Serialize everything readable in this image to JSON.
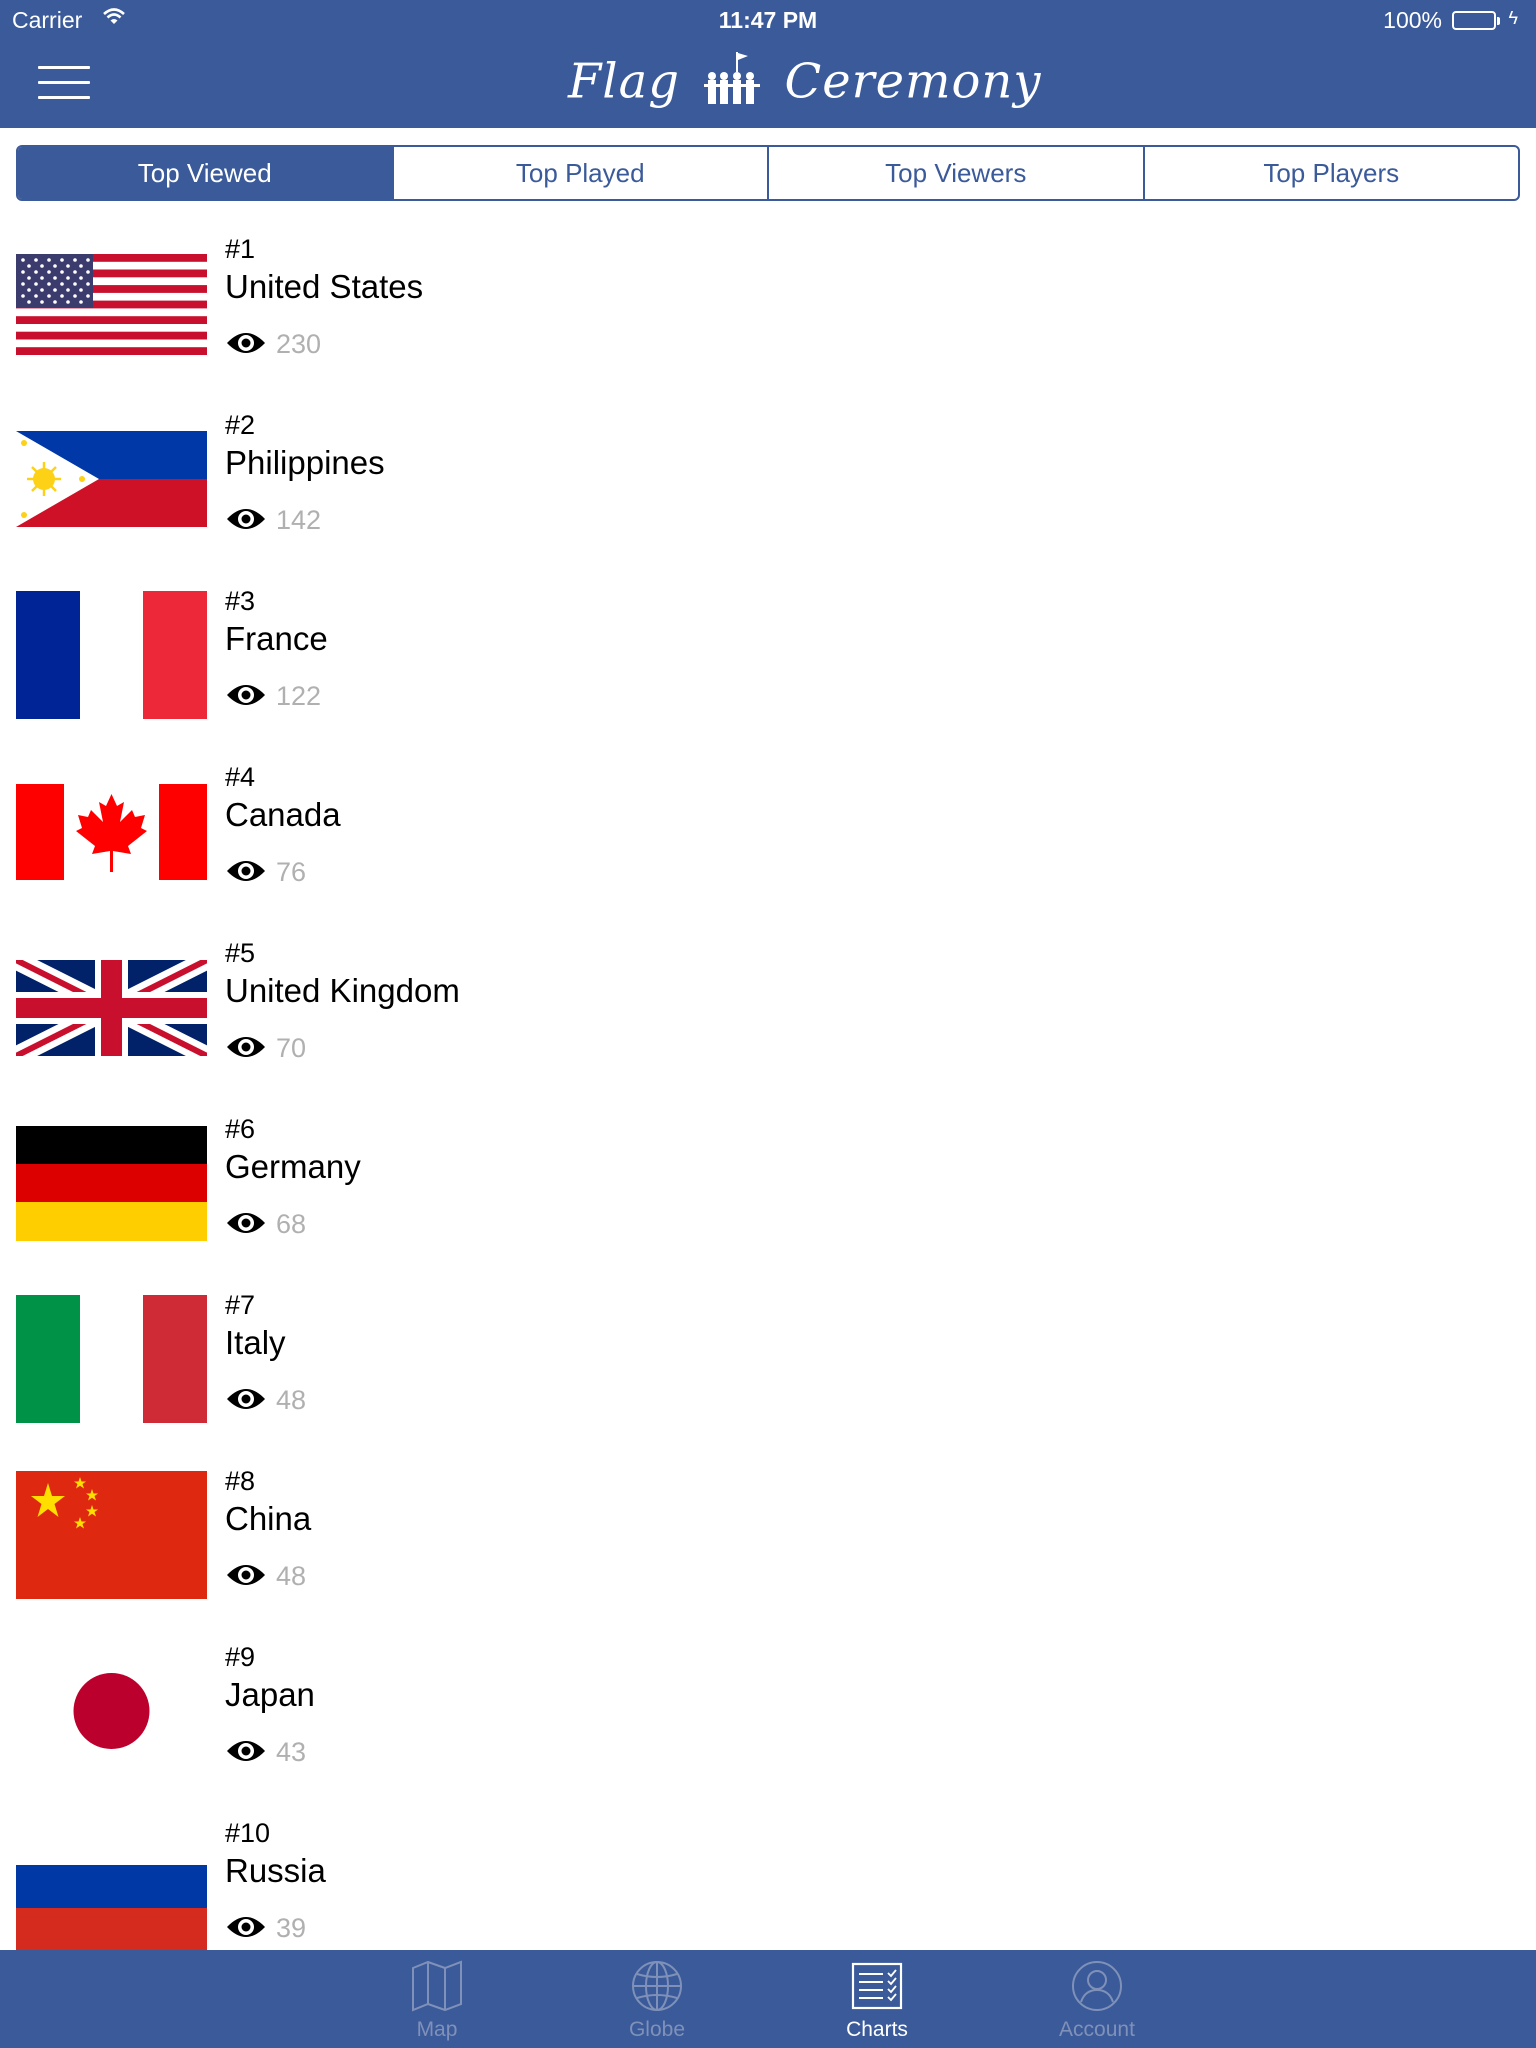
{
  "status_bar": {
    "carrier": "Carrier",
    "time": "11:47 PM",
    "battery": "100%"
  },
  "header": {
    "logo_left": "Flag",
    "logo_right": "Ceremony"
  },
  "segments": [
    {
      "label": "Top Viewed",
      "active": true
    },
    {
      "label": "Top Played",
      "active": false
    },
    {
      "label": "Top Viewers",
      "active": false
    },
    {
      "label": "Top Players",
      "active": false
    }
  ],
  "rankings": [
    {
      "rank": "#1",
      "country": "United States",
      "views": "230",
      "flag": "us-flag"
    },
    {
      "rank": "#2",
      "country": "Philippines",
      "views": "142",
      "flag": "philippines-flag"
    },
    {
      "rank": "#3",
      "country": "France",
      "views": "122",
      "flag": "france-flag"
    },
    {
      "rank": "#4",
      "country": "Canada",
      "views": "76",
      "flag": "canada-flag"
    },
    {
      "rank": "#5",
      "country": "United Kingdom",
      "views": "70",
      "flag": "uk-flag"
    },
    {
      "rank": "#6",
      "country": "Germany",
      "views": "68",
      "flag": "germany-flag"
    },
    {
      "rank": "#7",
      "country": "Italy",
      "views": "48",
      "flag": "italy-flag"
    },
    {
      "rank": "#8",
      "country": "China",
      "views": "48",
      "flag": "china-flag"
    },
    {
      "rank": "#9",
      "country": "Japan",
      "views": "43",
      "flag": "japan-flag"
    },
    {
      "rank": "#10",
      "country": "Russia",
      "views": "39",
      "flag": "russia-flag"
    }
  ],
  "tabbar": [
    {
      "label": "Map",
      "icon": "map-icon",
      "active": false
    },
    {
      "label": "Globe",
      "icon": "globe-icon",
      "active": false
    },
    {
      "label": "Charts",
      "icon": "charts-icon",
      "active": true
    },
    {
      "label": "Account",
      "icon": "account-icon",
      "active": false
    }
  ],
  "colors": {
    "brand": "#3b5a9a",
    "tab_inactive": "#7f91b8",
    "count_gray": "#b0b0b0"
  }
}
